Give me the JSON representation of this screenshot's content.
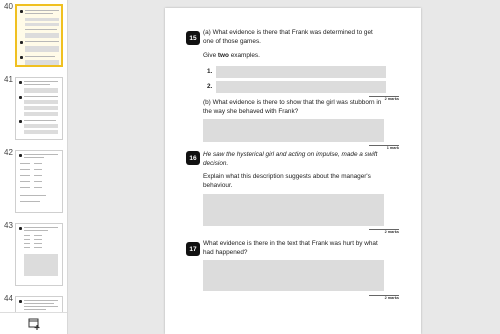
{
  "sidebar": {
    "pages": [
      {
        "number": "40",
        "selected": true
      },
      {
        "number": "41",
        "selected": false
      },
      {
        "number": "42",
        "selected": false
      },
      {
        "number": "43",
        "selected": false
      },
      {
        "number": "44",
        "selected": false
      }
    ]
  },
  "footer": {
    "add_icon": "add-page-icon"
  },
  "document": {
    "q15": {
      "number": "15",
      "part_a": "(a) What evidence is there that Frank was determined to get one of those games.",
      "give_prefix": "Give ",
      "give_bold": "two",
      "give_suffix": " examples.",
      "item1": "1.",
      "item2": "2.",
      "part_b": "(b) What evidence is there to show that the girl was stubborn in the way she behaved with Frank?",
      "marks_a": "2 marks",
      "marks_b": "1 mark"
    },
    "q16": {
      "number": "16",
      "quote": "He saw the hysterical girl and acting on impulse, made a swift decision.",
      "question": "Explain what this description suggests about the manager's behaviour.",
      "marks": "2 marks"
    },
    "q17": {
      "number": "17",
      "question": "What evidence is there in the text that Frank was hurt by what had happened?",
      "marks": "2 marks"
    }
  }
}
